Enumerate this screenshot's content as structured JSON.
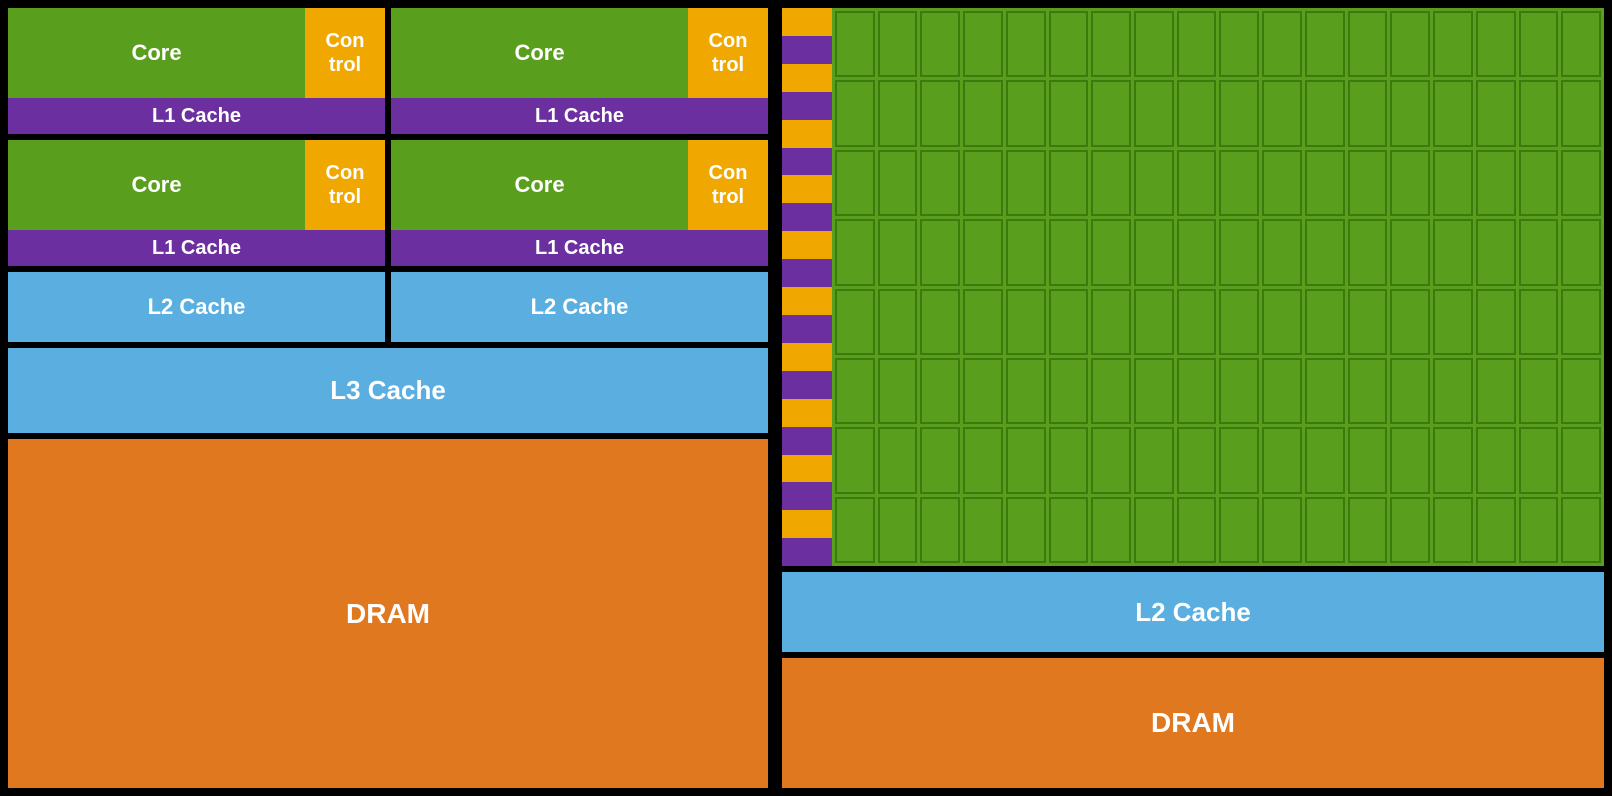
{
  "left": {
    "core1_label": "Core",
    "core2_label": "Core",
    "core3_label": "Core",
    "core4_label": "Core",
    "control_label": "Con\ntrol",
    "l1_cache_label": "L1 Cache",
    "l2_cache_label": "L2 Cache",
    "l3_cache_label": "L3 Cache",
    "dram_label": "DRAM",
    "colors": {
      "core_green": "#5a9e1e",
      "control_gold": "#f0a800",
      "l1_purple": "#6b2fa0",
      "l2_blue": "#5aafe0",
      "l3_blue": "#5aafe0",
      "dram_orange": "#e07820"
    }
  },
  "right": {
    "l2_cache_label": "L2 Cache",
    "dram_label": "DRAM",
    "stripe_count": 20,
    "grid_cols": 18,
    "grid_rows": 8,
    "colors": {
      "core_green": "#5a9e1e",
      "gold": "#f0a800",
      "purple": "#6b2fa0",
      "l2_blue": "#5aafe0",
      "dram_orange": "#e07820"
    }
  }
}
